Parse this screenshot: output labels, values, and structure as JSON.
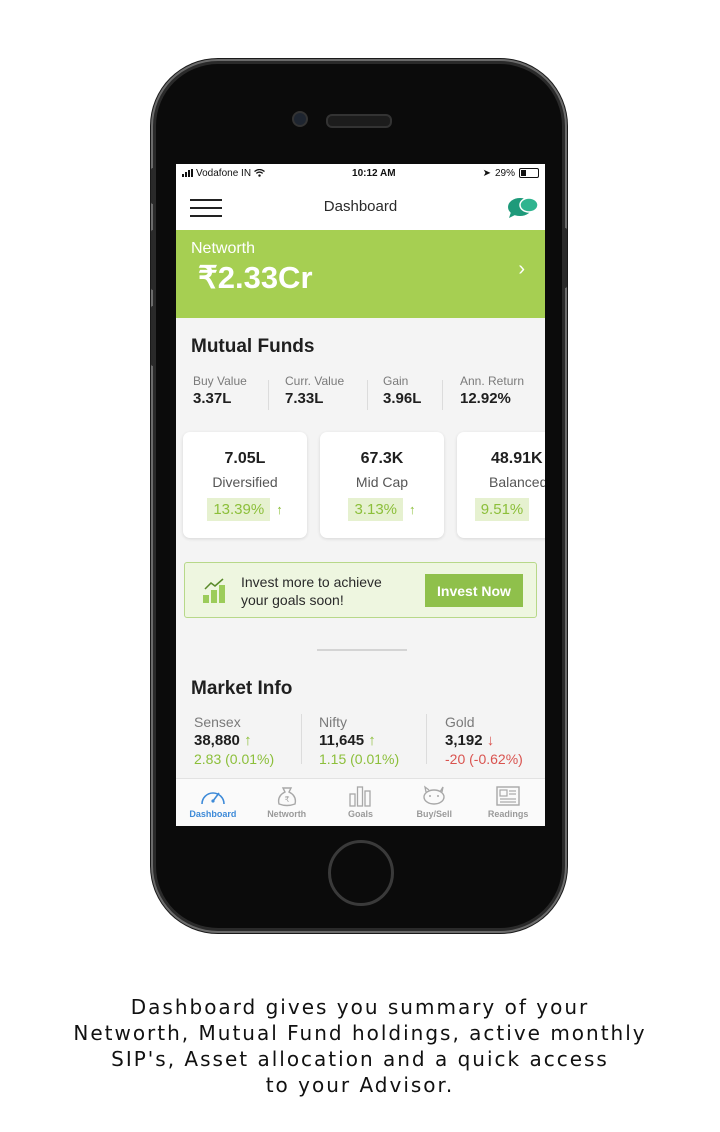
{
  "status_bar": {
    "carrier": "Vodafone IN",
    "time": "10:12 AM",
    "battery": "29%"
  },
  "header": {
    "title": "Dashboard"
  },
  "networth": {
    "label": "Networth",
    "value": "₹2.33Cr"
  },
  "mutual_funds": {
    "title": "Mutual Funds",
    "stats": [
      {
        "label": "Buy Value",
        "value": "3.37L"
      },
      {
        "label": "Curr. Value",
        "value": "7.33L"
      },
      {
        "label": "Gain",
        "value": "3.96L"
      },
      {
        "label": "Ann. Return",
        "value": "12.92%"
      }
    ],
    "cards": [
      {
        "value": "7.05L",
        "name": "Diversified",
        "return": "13.39%",
        "arrow": "↑"
      },
      {
        "value": "67.3K",
        "name": "Mid Cap",
        "return": "3.13%",
        "arrow": "↑"
      },
      {
        "value": "48.91K",
        "name": "Balanced",
        "return": "9.51%",
        "arrow": "↑"
      }
    ]
  },
  "invest_banner": {
    "text_line1": "Invest more to achieve",
    "text_line2": "your goals soon!",
    "button": "Invest Now"
  },
  "market_info": {
    "title": "Market Info",
    "items": [
      {
        "name": "Sensex",
        "value": "38,880",
        "arrow": "↑",
        "change": "2.83 (0.01%)",
        "direction": "up"
      },
      {
        "name": "Nifty",
        "value": "11,645",
        "arrow": "↑",
        "change": "1.15 (0.01%)",
        "direction": "up"
      },
      {
        "name": "Gold",
        "value": "3,192",
        "arrow": "↓",
        "change": "-20 (-0.62%)",
        "direction": "down"
      }
    ]
  },
  "tabs": [
    {
      "label": "Dashboard",
      "icon": "speedometer-icon",
      "active": true
    },
    {
      "label": "Networth",
      "icon": "rupee-bag-icon",
      "active": false
    },
    {
      "label": "Goals",
      "icon": "bar-chart-icon",
      "active": false
    },
    {
      "label": "Buy/Sell",
      "icon": "piggy-bank-icon",
      "active": false
    },
    {
      "label": "Readings",
      "icon": "newspaper-icon",
      "active": false
    }
  ],
  "caption": {
    "line1": "Dashboard gives you summary of your",
    "line2": "Networth, Mutual Fund holdings, active monthly",
    "line3": "SIP's, Asset allocation and a quick access",
    "line4": "to your Advisor."
  },
  "colors": {
    "networth_bg": "#a6cf52",
    "accent_green": "#8fc04b",
    "active_tab": "#3d8ad8",
    "down_red": "#d9534f"
  }
}
